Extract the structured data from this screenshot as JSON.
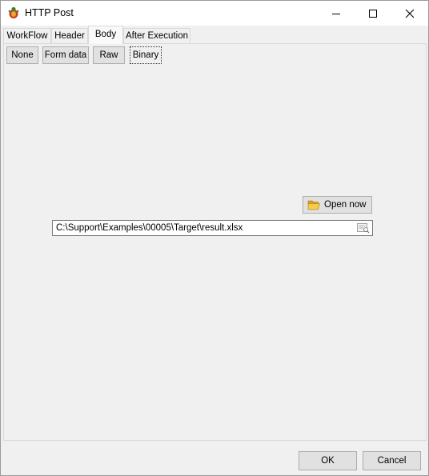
{
  "window": {
    "title": "HTTP Post",
    "icon": "app-bug-icon",
    "controls": [
      "minimize-icon",
      "maximize-icon",
      "close-icon"
    ]
  },
  "tabs": [
    {
      "label": "WorkFlow",
      "active": false
    },
    {
      "label": "Header",
      "active": false
    },
    {
      "label": "Body",
      "active": true
    },
    {
      "label": "After Execution",
      "active": false
    }
  ],
  "body": {
    "modes": [
      {
        "label": "None",
        "selected": false
      },
      {
        "label": "Form data",
        "selected": false
      },
      {
        "label": "Raw",
        "selected": false
      },
      {
        "label": "Binary",
        "selected": true
      }
    ],
    "open_now_label": "Open now",
    "file_path": "C:\\Support\\Examples\\00005\\Target\\result.xlsx"
  },
  "footer": {
    "ok_label": "OK",
    "cancel_label": "Cancel"
  }
}
